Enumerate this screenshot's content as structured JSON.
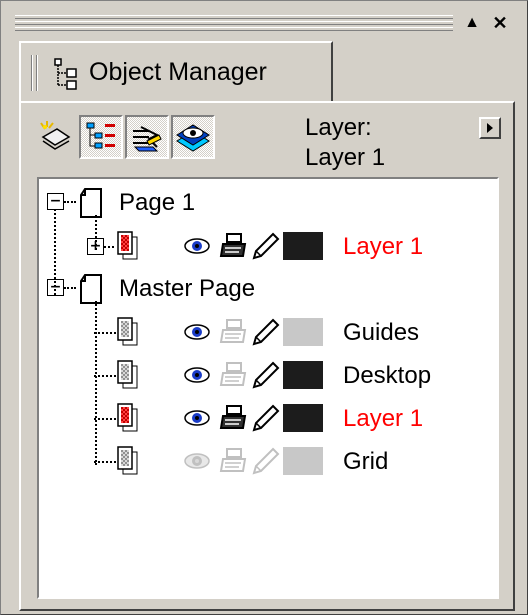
{
  "title_bar": {
    "collapse_glyph": "▲",
    "close_glyph": "✕"
  },
  "tab": {
    "label": "Object Manager"
  },
  "toolbar": {
    "tools": [
      "new-layer-tool",
      "show-properties-tool",
      "edit-across-layers-tool",
      "layer-manager-view-tool"
    ],
    "layer_caption": "Layer:",
    "layer_value": "Layer 1"
  },
  "tree": {
    "pages": [
      {
        "name": "Page 1",
        "layers": [
          {
            "name": "Layer 1",
            "color": "#ff0000",
            "swatch": "#1c1c1c",
            "visible": true,
            "printable": true,
            "editable": true
          }
        ]
      },
      {
        "name": "Master Page",
        "layers": [
          {
            "name": "Guides",
            "color": "#000000",
            "swatch": "#c8c8c8",
            "visible": true,
            "printable": false,
            "editable": true
          },
          {
            "name": "Desktop",
            "color": "#000000",
            "swatch": "#1c1c1c",
            "visible": true,
            "printable": false,
            "editable": true
          },
          {
            "name": "Layer 1",
            "color": "#ff0000",
            "swatch": "#1c1c1c",
            "visible": true,
            "printable": true,
            "editable": true
          },
          {
            "name": "Grid",
            "color": "#000000",
            "swatch": "#c8c8c8",
            "visible": false,
            "printable": false,
            "editable": false
          }
        ]
      }
    ]
  }
}
